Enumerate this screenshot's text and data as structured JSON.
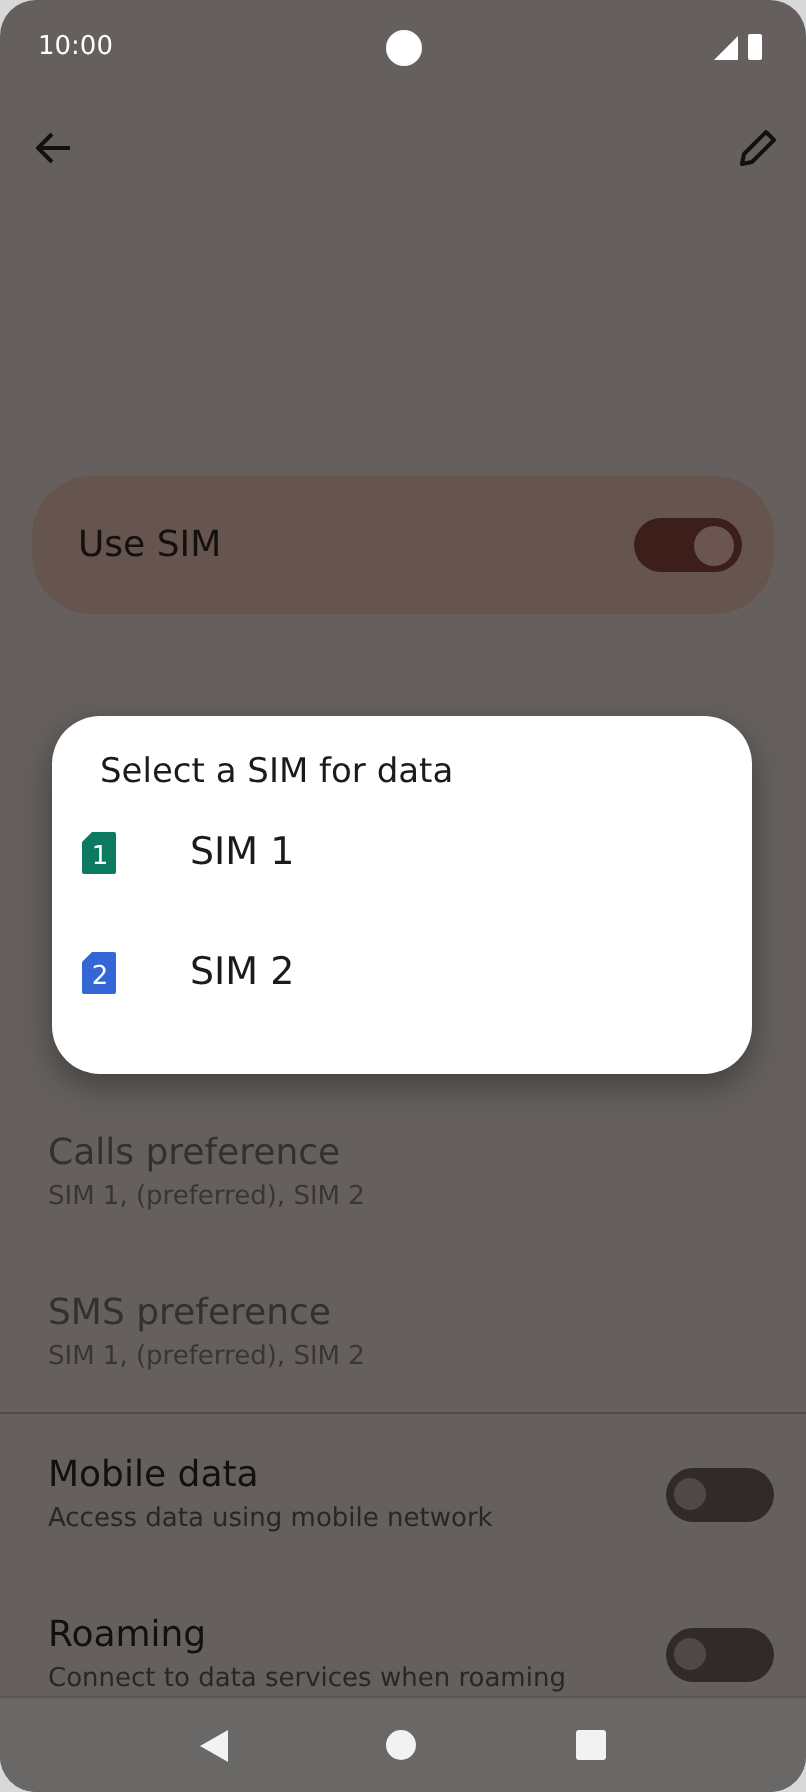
{
  "status_bar": {
    "time": "10:00"
  },
  "use_sim": {
    "label": "Use SIM",
    "on": true
  },
  "settings": [
    {
      "kind": "pref",
      "title": "Calls preference",
      "subtitle": "SIM 1, (preferred), SIM 2",
      "disabled": true
    },
    {
      "kind": "pref",
      "title": "SMS preference",
      "subtitle": "SIM 1, (preferred), SIM 2",
      "disabled": true
    },
    {
      "kind": "divider"
    },
    {
      "kind": "toggle",
      "title": "Mobile data",
      "subtitle": "Access data using mobile network",
      "on": false
    },
    {
      "kind": "toggle",
      "title": "Roaming",
      "subtitle": "Connect to data services when roaming",
      "on": false
    }
  ],
  "dialog": {
    "title": "Select a SIM for data",
    "options": [
      {
        "label": "SIM 1",
        "badge": "1",
        "color": "#0b7a61"
      },
      {
        "label": "SIM 2",
        "badge": "2",
        "color": "#3566d6"
      }
    ]
  }
}
